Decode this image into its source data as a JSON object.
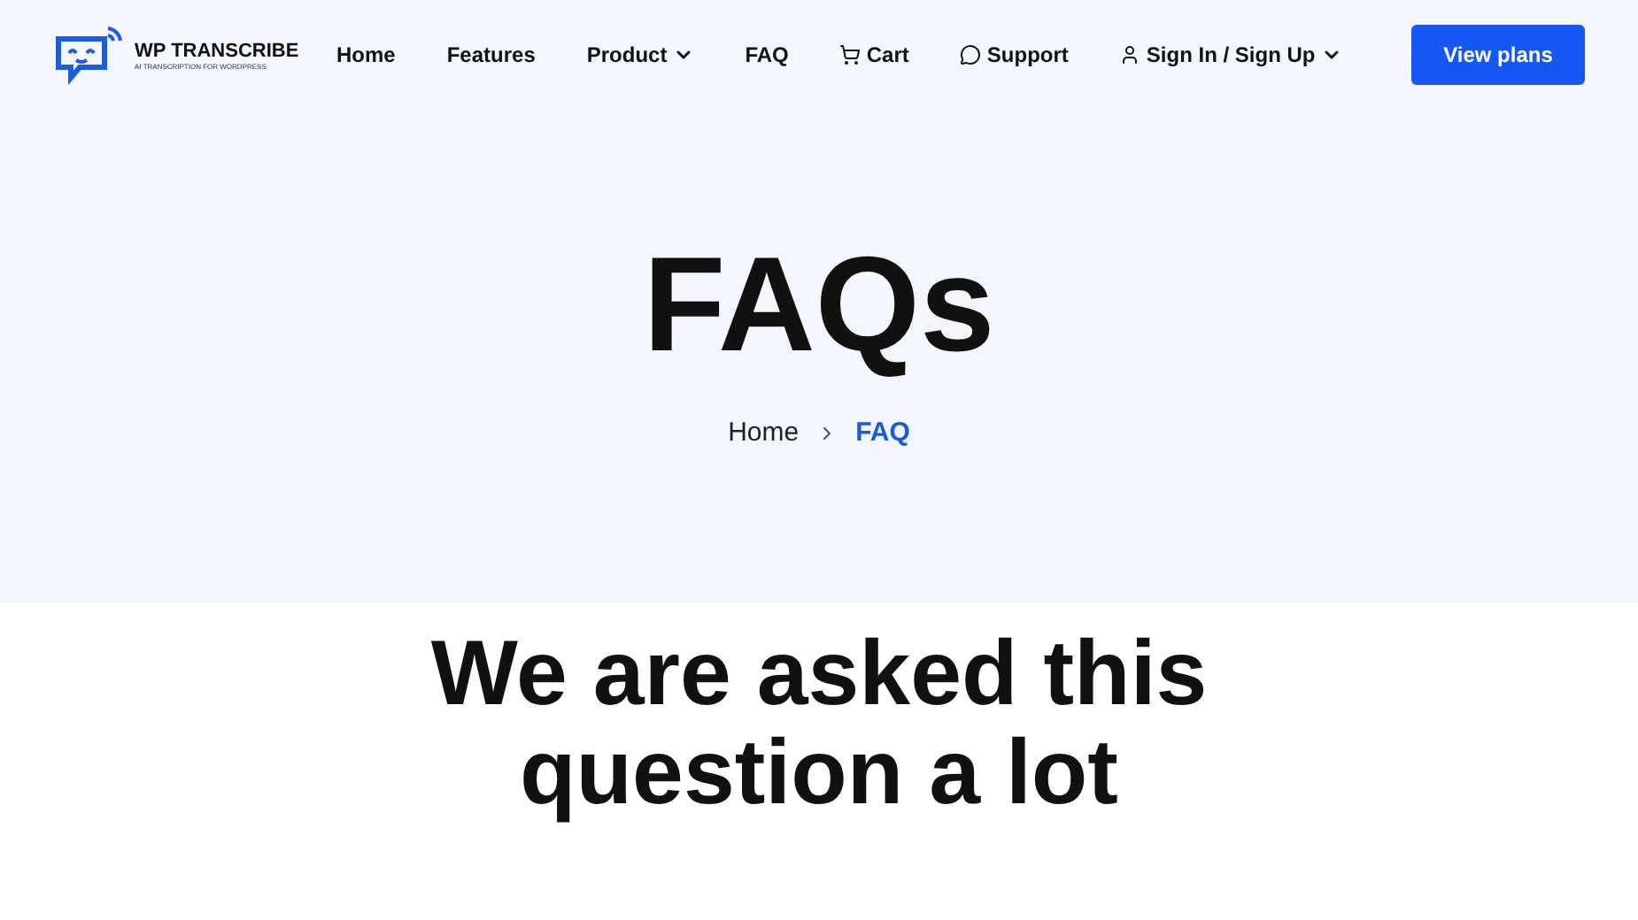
{
  "logo": {
    "name": "WP TRANSCRIBE",
    "tagline": "AI TRANSCRIPTION FOR WORDPRESS"
  },
  "nav": [
    {
      "label": "Home",
      "kind": "plain"
    },
    {
      "label": "Features",
      "kind": "plain"
    },
    {
      "label": "Product",
      "kind": "dropdown"
    },
    {
      "label": "FAQ",
      "kind": "plain"
    },
    {
      "label": "Cart",
      "kind": "cart"
    },
    {
      "label": "Support",
      "kind": "support"
    },
    {
      "label": "Sign In / Sign Up",
      "kind": "account"
    }
  ],
  "cta": "View plans",
  "hero": {
    "title": "FAQs",
    "breadcrumb": [
      {
        "label": "Home",
        "selected": false
      },
      {
        "label": "FAQ",
        "selected": true
      }
    ]
  },
  "section": {
    "heading": "We are asked this question a lot"
  }
}
